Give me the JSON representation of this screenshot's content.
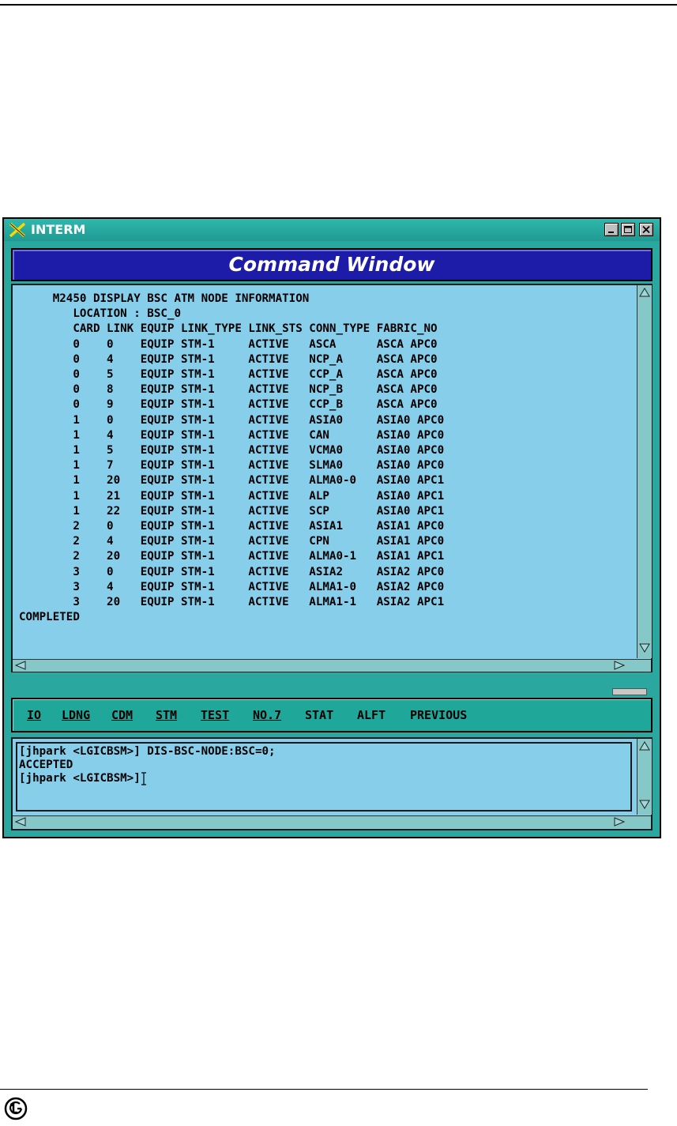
{
  "window": {
    "title": "INTERM",
    "minimize_icon": "minimize-icon",
    "maximize_icon": "maximize-icon",
    "close_icon": "close-icon"
  },
  "header": {
    "title": "Command Window"
  },
  "output": {
    "lines": [
      "     M2450 DISPLAY BSC ATM NODE INFORMATION",
      "        LOCATION : BSC_0",
      "        CARD LINK EQUIP LINK_TYPE LINK_STS CONN_TYPE FABRIC_NO",
      "        0    0    EQUIP STM-1     ACTIVE   ASCA      ASCA APC0",
      "        0    4    EQUIP STM-1     ACTIVE   NCP_A     ASCA APC0",
      "        0    5    EQUIP STM-1     ACTIVE   CCP_A     ASCA APC0",
      "        0    8    EQUIP STM-1     ACTIVE   NCP_B     ASCA APC0",
      "        0    9    EQUIP STM-1     ACTIVE   CCP_B     ASCA APC0",
      "        1    0    EQUIP STM-1     ACTIVE   ASIA0     ASIA0 APC0",
      "        1    4    EQUIP STM-1     ACTIVE   CAN       ASIA0 APC0",
      "        1    5    EQUIP STM-1     ACTIVE   VCMA0     ASIA0 APC0",
      "        1    7    EQUIP STM-1     ACTIVE   SLMA0     ASIA0 APC0",
      "        1    20   EQUIP STM-1     ACTIVE   ALMA0-0   ASIA0 APC1",
      "        1    21   EQUIP STM-1     ACTIVE   ALP       ASIA0 APC1",
      "        1    22   EQUIP STM-1     ACTIVE   SCP       ASIA0 APC1",
      "        2    0    EQUIP STM-1     ACTIVE   ASIA1     ASIA1 APC0",
      "        2    4    EQUIP STM-1     ACTIVE   CPN       ASIA1 APC0",
      "        2    20   EQUIP STM-1     ACTIVE   ALMA0-1   ASIA1 APC1",
      "        3    0    EQUIP STM-1     ACTIVE   ASIA2     ASIA2 APC0",
      "        3    4    EQUIP STM-1     ACTIVE   ALMA1-0   ASIA2 APC0",
      "        3    20   EQUIP STM-1     ACTIVE   ALMA1-1   ASIA2 APC1",
      "COMPLETED"
    ]
  },
  "menu": {
    "items": [
      {
        "label": "IO"
      },
      {
        "label": "LDNG"
      },
      {
        "label": "CDM"
      },
      {
        "label": "STM"
      },
      {
        "label": "TEST"
      },
      {
        "label": "NO.7"
      },
      {
        "label": "STAT"
      },
      {
        "label": "ALFT"
      },
      {
        "label": "PREVIOUS"
      }
    ]
  },
  "input": {
    "lines": [
      "[jhpark <LGICBSM>] DIS-BSC-NODE:BSC=0;",
      "ACCEPTED",
      "[jhpark <LGICBSM>]"
    ]
  },
  "footer": {
    "logo_icon": "lg-logo-icon"
  },
  "colors": {
    "window_frame": "#2aa8a0",
    "header_bg": "#1c1ca8",
    "panel_bg": "#87ceeb",
    "menu_bg": "#1fa89a"
  }
}
